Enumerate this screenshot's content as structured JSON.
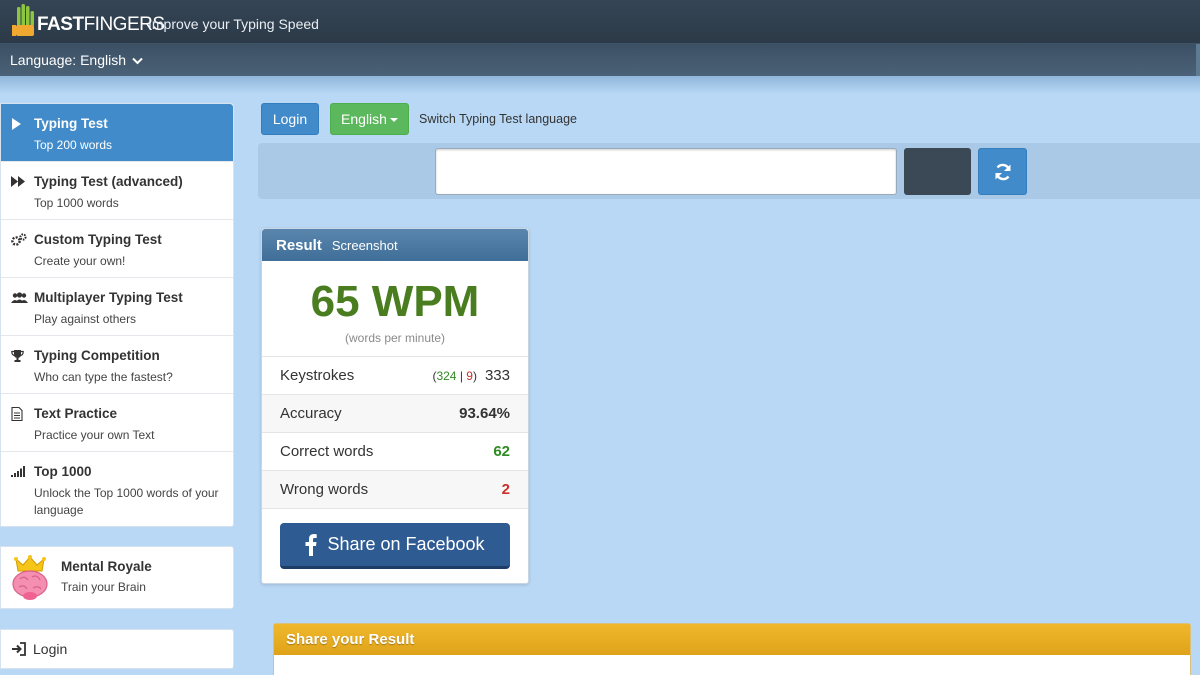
{
  "header": {
    "logo_text_bold": "FAST",
    "logo_text_thin": "FINGERS",
    "tagline": "Improve your Typing Speed",
    "language_select": "Language: English"
  },
  "sidebar": {
    "items": [
      {
        "title": "Typing Test",
        "sub": "Top 200 words",
        "icon": "play-icon"
      },
      {
        "title": "Typing Test (advanced)",
        "sub": "Top 1000 words",
        "icon": "fast-forward-icon"
      },
      {
        "title": "Custom Typing Test",
        "sub": "Create your own!",
        "icon": "gears-icon"
      },
      {
        "title": "Multiplayer Typing Test",
        "sub": "Play against others",
        "icon": "users-icon"
      },
      {
        "title": "Typing Competition",
        "sub": "Who can type the fastest?",
        "icon": "trophy-icon"
      },
      {
        "title": "Text Practice",
        "sub": "Practice your own Text",
        "icon": "document-icon"
      },
      {
        "title": "Top 1000",
        "sub": "Unlock the Top 1000 words of your language",
        "icon": "signal-bars-icon"
      }
    ],
    "promo": {
      "title": "Mental Royale",
      "sub": "Train your Brain",
      "icon": "crowned-brain-icon"
    },
    "login": "Login"
  },
  "toolbar": {
    "login_label": "Login",
    "language_label": "English",
    "switch_label": "Switch Typing Test language"
  },
  "result": {
    "title": "Result",
    "screenshot_label": "Screenshot",
    "wpm": "65 WPM",
    "wpm_caption": "(words per minute)",
    "keystrokes_label": "Keystrokes",
    "keystrokes_open": "(",
    "keystrokes_correct": "324",
    "keystrokes_sep": "|",
    "keystrokes_wrong": "9",
    "keystrokes_close": ")",
    "keystrokes_total": "333",
    "accuracy_label": "Accuracy",
    "accuracy_value": "93.64%",
    "correct_label": "Correct words",
    "correct_value": "62",
    "wrong_label": "Wrong words",
    "wrong_value": "2",
    "facebook_label": "Share on Facebook"
  },
  "share": {
    "title": "Share your Result"
  },
  "colors": {
    "page_bg": "#b9d8f5",
    "primary": "#428bca",
    "success": "#5cb85c",
    "wpm_green": "#4a7d1f",
    "facebook": "#2f5b93",
    "share_header": "#e8ad22"
  }
}
